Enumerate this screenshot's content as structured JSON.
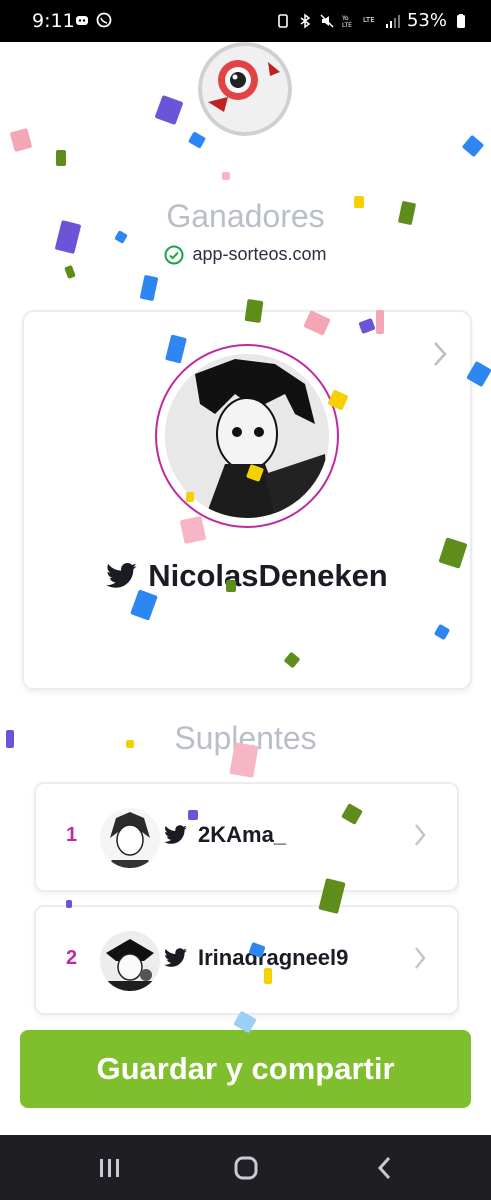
{
  "status_bar": {
    "time": "9:11",
    "battery": "53%"
  },
  "header": {
    "title": "Ganadores",
    "site": "app-sorteos.com"
  },
  "winner": {
    "username": "NicolasDeneken"
  },
  "alternates": {
    "title": "Suplentes",
    "items": [
      {
        "rank": "1",
        "username": "2KAma_"
      },
      {
        "rank": "2",
        "username": "Irinadragneel9"
      }
    ]
  },
  "cta": {
    "label": "Guardar y compartir"
  },
  "colors": {
    "accent_green": "#7fbf2d",
    "rank_color": "#c02aa0",
    "title_gray": "#b9bec8"
  },
  "icons": {
    "verified": "check-circle-icon",
    "twitter": "twitter-bird-icon",
    "chevron": "chevron-right-icon"
  }
}
